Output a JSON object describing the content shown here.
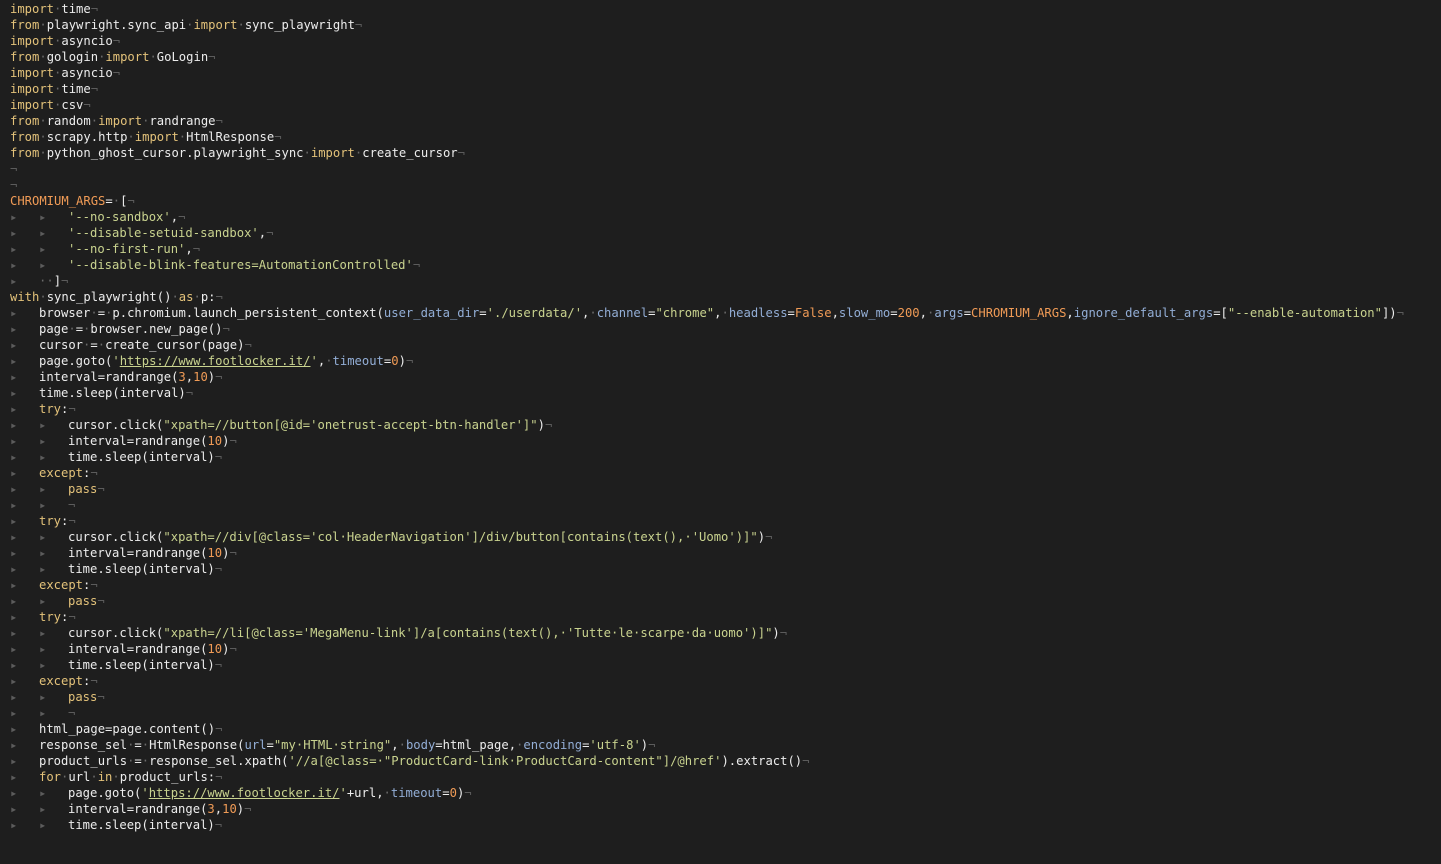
{
  "editor": {
    "colors": {
      "background": "#1e1e1e",
      "keyword": "#e3c27a",
      "identifier": "#ededed",
      "string": "#c9d38f",
      "number": "#f09b56",
      "kwarg": "#93aed6",
      "invisible": "#5c5c5c"
    },
    "lines": [
      [
        [
          "kw",
          "import"
        ],
        [
          "dot",
          "·"
        ],
        [
          "id",
          "time"
        ],
        [
          "inv",
          "¬"
        ]
      ],
      [
        [
          "kw",
          "from"
        ],
        [
          "dot",
          "·"
        ],
        [
          "id",
          "playwright.sync_api"
        ],
        [
          "dot",
          "·"
        ],
        [
          "kw",
          "import"
        ],
        [
          "dot",
          "·"
        ],
        [
          "id",
          "sync_playwright"
        ],
        [
          "inv",
          "¬"
        ]
      ],
      [
        [
          "kw",
          "import"
        ],
        [
          "dot",
          "·"
        ],
        [
          "id",
          "asyncio"
        ],
        [
          "inv",
          "¬"
        ]
      ],
      [
        [
          "kw",
          "from"
        ],
        [
          "dot",
          "·"
        ],
        [
          "id",
          "gologin"
        ],
        [
          "dot",
          "·"
        ],
        [
          "kw",
          "import"
        ],
        [
          "dot",
          "·"
        ],
        [
          "id",
          "GoLogin"
        ],
        [
          "inv",
          "¬"
        ]
      ],
      [
        [
          "kw",
          "import"
        ],
        [
          "dot",
          "·"
        ],
        [
          "id",
          "asyncio"
        ],
        [
          "inv",
          "¬"
        ]
      ],
      [
        [
          "kw",
          "import"
        ],
        [
          "dot",
          "·"
        ],
        [
          "id",
          "time"
        ],
        [
          "inv",
          "¬"
        ]
      ],
      [
        [
          "kw",
          "import"
        ],
        [
          "dot",
          "·"
        ],
        [
          "id",
          "csv"
        ],
        [
          "inv",
          "¬"
        ]
      ],
      [
        [
          "kw",
          "from"
        ],
        [
          "dot",
          "·"
        ],
        [
          "id",
          "random"
        ],
        [
          "dot",
          "·"
        ],
        [
          "kw",
          "import"
        ],
        [
          "dot",
          "·"
        ],
        [
          "id",
          "randrange"
        ],
        [
          "inv",
          "¬"
        ]
      ],
      [
        [
          "kw",
          "from"
        ],
        [
          "dot",
          "·"
        ],
        [
          "id",
          "scrapy.http"
        ],
        [
          "dot",
          "·"
        ],
        [
          "kw",
          "import"
        ],
        [
          "dot",
          "·"
        ],
        [
          "id",
          "HtmlResponse"
        ],
        [
          "inv",
          "¬"
        ]
      ],
      [
        [
          "kw",
          "from"
        ],
        [
          "dot",
          "·"
        ],
        [
          "id",
          "python_ghost_cursor.playwright_sync"
        ],
        [
          "dot",
          "·"
        ],
        [
          "kw",
          "import"
        ],
        [
          "dot",
          "·"
        ],
        [
          "id",
          "create_cursor"
        ],
        [
          "inv",
          "¬"
        ]
      ],
      [
        [
          "inv",
          "¬"
        ]
      ],
      [
        [
          "inv",
          "¬"
        ]
      ],
      [
        [
          "const",
          "CHROMIUM_ARGS"
        ],
        [
          "op",
          "="
        ],
        [
          "dot",
          "·"
        ],
        [
          "op",
          "["
        ],
        [
          "inv",
          "¬"
        ]
      ],
      [
        [
          "tab",
          "▸"
        ],
        [
          "tab",
          "▸"
        ],
        [
          "str",
          "'--no-sandbox'"
        ],
        [
          "op",
          ","
        ],
        [
          "inv",
          "¬"
        ]
      ],
      [
        [
          "tab",
          "▸"
        ],
        [
          "tab",
          "▸"
        ],
        [
          "str",
          "'--disable-setuid-sandbox'"
        ],
        [
          "op",
          ","
        ],
        [
          "inv",
          "¬"
        ]
      ],
      [
        [
          "tab",
          "▸"
        ],
        [
          "tab",
          "▸"
        ],
        [
          "str",
          "'--no-first-run'"
        ],
        [
          "op",
          ","
        ],
        [
          "inv",
          "¬"
        ]
      ],
      [
        [
          "tab",
          "▸"
        ],
        [
          "tab",
          "▸"
        ],
        [
          "str",
          "'--disable-blink-features=AutomationControlled'"
        ],
        [
          "inv",
          "¬"
        ]
      ],
      [
        [
          "tab",
          "▸"
        ],
        [
          "dot",
          "·"
        ],
        [
          "dot",
          "·"
        ],
        [
          "op",
          "]"
        ],
        [
          "inv",
          "¬"
        ]
      ],
      [
        [
          "kw",
          "with"
        ],
        [
          "dot",
          "·"
        ],
        [
          "id",
          "sync_playwright()"
        ],
        [
          "dot",
          "·"
        ],
        [
          "kw",
          "as"
        ],
        [
          "dot",
          "·"
        ],
        [
          "id",
          "p:"
        ],
        [
          "inv",
          "¬"
        ]
      ],
      [
        [
          "tab",
          "▸"
        ],
        [
          "id",
          "browser"
        ],
        [
          "dot",
          "·"
        ],
        [
          "op",
          "="
        ],
        [
          "dot",
          "·"
        ],
        [
          "id",
          "p.chromium.launch_persistent_context("
        ],
        [
          "kwarg",
          "user_data_dir"
        ],
        [
          "op",
          "="
        ],
        [
          "str",
          "'./userdata/'"
        ],
        [
          "op",
          ","
        ],
        [
          "dot",
          "·"
        ],
        [
          "kwarg",
          "channel"
        ],
        [
          "op",
          "="
        ],
        [
          "str",
          "\"chrome\""
        ],
        [
          "op",
          ","
        ],
        [
          "dot",
          "·"
        ],
        [
          "kwarg",
          "headless"
        ],
        [
          "op",
          "="
        ],
        [
          "bool",
          "False"
        ],
        [
          "op",
          ","
        ],
        [
          "kwarg",
          "slow_mo"
        ],
        [
          "op",
          "="
        ],
        [
          "num",
          "200"
        ],
        [
          "op",
          ","
        ],
        [
          "dot",
          "·"
        ],
        [
          "kwarg",
          "args"
        ],
        [
          "op",
          "="
        ],
        [
          "const",
          "CHROMIUM_ARGS"
        ],
        [
          "op",
          ","
        ],
        [
          "kwarg",
          "ignore_default_args"
        ],
        [
          "op",
          "=["
        ],
        [
          "str",
          "\"--enable-automation\""
        ],
        [
          "op",
          "])"
        ],
        [
          "inv",
          "¬"
        ]
      ],
      [
        [
          "tab",
          "▸"
        ],
        [
          "id",
          "page"
        ],
        [
          "dot",
          "·"
        ],
        [
          "op",
          "="
        ],
        [
          "dot",
          "·"
        ],
        [
          "id",
          "browser.new_page()"
        ],
        [
          "inv",
          "¬"
        ]
      ],
      [
        [
          "tab",
          "▸"
        ],
        [
          "id",
          "cursor"
        ],
        [
          "dot",
          "·"
        ],
        [
          "op",
          "="
        ],
        [
          "dot",
          "·"
        ],
        [
          "id",
          "create_cursor(page)"
        ],
        [
          "inv",
          "¬"
        ]
      ],
      [
        [
          "tab",
          "▸"
        ],
        [
          "id",
          "page.goto("
        ],
        [
          "str",
          "'"
        ],
        [
          "url",
          "https://www.footlocker.it/"
        ],
        [
          "str",
          "'"
        ],
        [
          "op",
          ","
        ],
        [
          "dot",
          "·"
        ],
        [
          "kwarg",
          "timeout"
        ],
        [
          "op",
          "="
        ],
        [
          "num",
          "0"
        ],
        [
          "op",
          ")"
        ],
        [
          "inv",
          "¬"
        ]
      ],
      [
        [
          "tab",
          "▸"
        ],
        [
          "id",
          "interval=randrange("
        ],
        [
          "num",
          "3"
        ],
        [
          "op",
          ","
        ],
        [
          "num",
          "10"
        ],
        [
          "op",
          ")"
        ],
        [
          "inv",
          "¬"
        ]
      ],
      [
        [
          "tab",
          "▸"
        ],
        [
          "id",
          "time.sleep(interval)"
        ],
        [
          "inv",
          "¬"
        ]
      ],
      [
        [
          "tab",
          "▸"
        ],
        [
          "kw",
          "try"
        ],
        [
          "op",
          ":"
        ],
        [
          "inv",
          "¬"
        ]
      ],
      [
        [
          "tab",
          "▸"
        ],
        [
          "tab",
          "▸"
        ],
        [
          "id",
          "cursor.click("
        ],
        [
          "str",
          "\"xpath=//button[@id='onetrust-accept-btn-handler']\""
        ],
        [
          "op",
          ")"
        ],
        [
          "inv",
          "¬"
        ]
      ],
      [
        [
          "tab",
          "▸"
        ],
        [
          "tab",
          "▸"
        ],
        [
          "id",
          "interval=randrange("
        ],
        [
          "num",
          "10"
        ],
        [
          "op",
          ")"
        ],
        [
          "inv",
          "¬"
        ]
      ],
      [
        [
          "tab",
          "▸"
        ],
        [
          "tab",
          "▸"
        ],
        [
          "id",
          "time.sleep(interval)"
        ],
        [
          "inv",
          "¬"
        ]
      ],
      [
        [
          "tab",
          "▸"
        ],
        [
          "kw",
          "except"
        ],
        [
          "op",
          ":"
        ],
        [
          "inv",
          "¬"
        ]
      ],
      [
        [
          "tab",
          "▸"
        ],
        [
          "tab",
          "▸"
        ],
        [
          "kw",
          "pass"
        ],
        [
          "inv",
          "¬"
        ]
      ],
      [
        [
          "tab",
          "▸"
        ],
        [
          "tab",
          "▸"
        ],
        [
          "inv",
          "¬"
        ]
      ],
      [
        [
          "tab",
          "▸"
        ],
        [
          "kw",
          "try"
        ],
        [
          "op",
          ":"
        ],
        [
          "inv",
          "¬"
        ]
      ],
      [
        [
          "tab",
          "▸"
        ],
        [
          "tab",
          "▸"
        ],
        [
          "id",
          "cursor.click("
        ],
        [
          "str",
          "\"xpath=//div[@class='col·HeaderNavigation']/div/button[contains(text(),·'Uomo')]\""
        ],
        [
          "op",
          ")"
        ],
        [
          "inv",
          "¬"
        ]
      ],
      [
        [
          "tab",
          "▸"
        ],
        [
          "tab",
          "▸"
        ],
        [
          "id",
          "interval=randrange("
        ],
        [
          "num",
          "10"
        ],
        [
          "op",
          ")"
        ],
        [
          "inv",
          "¬"
        ]
      ],
      [
        [
          "tab",
          "▸"
        ],
        [
          "tab",
          "▸"
        ],
        [
          "id",
          "time.sleep(interval)"
        ],
        [
          "inv",
          "¬"
        ]
      ],
      [
        [
          "tab",
          "▸"
        ],
        [
          "kw",
          "except"
        ],
        [
          "op",
          ":"
        ],
        [
          "inv",
          "¬"
        ]
      ],
      [
        [
          "tab",
          "▸"
        ],
        [
          "tab",
          "▸"
        ],
        [
          "kw",
          "pass"
        ],
        [
          "inv",
          "¬"
        ]
      ],
      [
        [
          "tab",
          "▸"
        ],
        [
          "kw",
          "try"
        ],
        [
          "op",
          ":"
        ],
        [
          "inv",
          "¬"
        ]
      ],
      [
        [
          "tab",
          "▸"
        ],
        [
          "tab",
          "▸"
        ],
        [
          "id",
          "cursor.click("
        ],
        [
          "str",
          "\"xpath=//li[@class='MegaMenu-link']/a[contains(text(),·'Tutte·le·scarpe·da·uomo')]\""
        ],
        [
          "op",
          ")"
        ],
        [
          "inv",
          "¬"
        ]
      ],
      [
        [
          "tab",
          "▸"
        ],
        [
          "tab",
          "▸"
        ],
        [
          "id",
          "interval=randrange("
        ],
        [
          "num",
          "10"
        ],
        [
          "op",
          ")"
        ],
        [
          "inv",
          "¬"
        ]
      ],
      [
        [
          "tab",
          "▸"
        ],
        [
          "tab",
          "▸"
        ],
        [
          "id",
          "time.sleep(interval)"
        ],
        [
          "inv",
          "¬"
        ]
      ],
      [
        [
          "tab",
          "▸"
        ],
        [
          "kw",
          "except"
        ],
        [
          "op",
          ":"
        ],
        [
          "inv",
          "¬"
        ]
      ],
      [
        [
          "tab",
          "▸"
        ],
        [
          "tab",
          "▸"
        ],
        [
          "kw",
          "pass"
        ],
        [
          "inv",
          "¬"
        ]
      ],
      [
        [
          "tab",
          "▸"
        ],
        [
          "tab",
          "▸"
        ],
        [
          "inv",
          "¬"
        ]
      ],
      [
        [
          "tab",
          "▸"
        ],
        [
          "id",
          "html_page=page.content()"
        ],
        [
          "inv",
          "¬"
        ]
      ],
      [
        [
          "tab",
          "▸"
        ],
        [
          "id",
          "response_sel"
        ],
        [
          "dot",
          "·"
        ],
        [
          "op",
          "="
        ],
        [
          "dot",
          "·"
        ],
        [
          "id",
          "HtmlResponse("
        ],
        [
          "kwarg",
          "url"
        ],
        [
          "op",
          "="
        ],
        [
          "str",
          "\"my·HTML·string\""
        ],
        [
          "op",
          ","
        ],
        [
          "dot",
          "·"
        ],
        [
          "kwarg",
          "body"
        ],
        [
          "op",
          "="
        ],
        [
          "id",
          "html_page"
        ],
        [
          "op",
          ","
        ],
        [
          "dot",
          "·"
        ],
        [
          "kwarg",
          "encoding"
        ],
        [
          "op",
          "="
        ],
        [
          "str",
          "'utf-8'"
        ],
        [
          "op",
          ")"
        ],
        [
          "inv",
          "¬"
        ]
      ],
      [
        [
          "tab",
          "▸"
        ],
        [
          "id",
          "product_urls"
        ],
        [
          "dot",
          "·"
        ],
        [
          "op",
          "="
        ],
        [
          "dot",
          "·"
        ],
        [
          "id",
          "response_sel.xpath("
        ],
        [
          "str",
          "'//a[@class=·\"ProductCard-link·ProductCard-content\"]/@href'"
        ],
        [
          "op",
          ").extract()"
        ],
        [
          "inv",
          "¬"
        ]
      ],
      [
        [
          "tab",
          "▸"
        ],
        [
          "kw",
          "for"
        ],
        [
          "dot",
          "·"
        ],
        [
          "id",
          "url"
        ],
        [
          "dot",
          "·"
        ],
        [
          "kw",
          "in"
        ],
        [
          "dot",
          "·"
        ],
        [
          "id",
          "product_urls:"
        ],
        [
          "inv",
          "¬"
        ]
      ],
      [
        [
          "tab",
          "▸"
        ],
        [
          "tab",
          "▸"
        ],
        [
          "id",
          "page.goto("
        ],
        [
          "str",
          "'"
        ],
        [
          "url",
          "https://www.footlocker.it/"
        ],
        [
          "str",
          "'"
        ],
        [
          "op",
          "+url,"
        ],
        [
          "dot",
          "·"
        ],
        [
          "kwarg",
          "timeout"
        ],
        [
          "op",
          "="
        ],
        [
          "num",
          "0"
        ],
        [
          "op",
          ")"
        ],
        [
          "inv",
          "¬"
        ]
      ],
      [
        [
          "tab",
          "▸"
        ],
        [
          "tab",
          "▸"
        ],
        [
          "id",
          "interval=randrange("
        ],
        [
          "num",
          "3"
        ],
        [
          "op",
          ","
        ],
        [
          "num",
          "10"
        ],
        [
          "op",
          ")"
        ],
        [
          "inv",
          "¬"
        ]
      ],
      [
        [
          "tab",
          "▸"
        ],
        [
          "tab",
          "▸"
        ],
        [
          "id",
          "time.sleep(interval)"
        ],
        [
          "inv",
          "¬"
        ]
      ]
    ]
  }
}
